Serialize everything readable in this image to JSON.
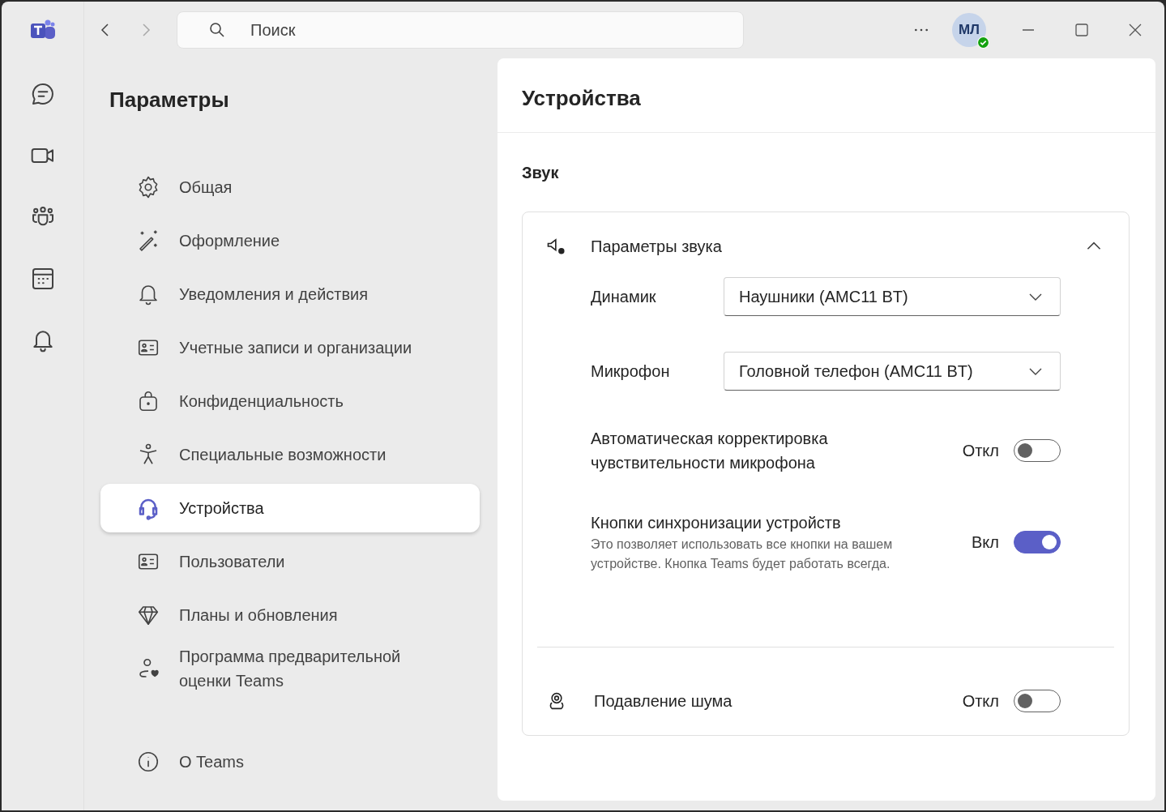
{
  "search": {
    "placeholder": "Поиск"
  },
  "avatar": {
    "initials": "МЛ"
  },
  "settings_nav": {
    "title": "Параметры",
    "items": [
      {
        "label": "Общая",
        "selected": false
      },
      {
        "label": "Оформление",
        "selected": false
      },
      {
        "label": "Уведомления и действия",
        "selected": false
      },
      {
        "label": "Учетные записи и организации",
        "selected": false
      },
      {
        "label": "Конфиденциальность",
        "selected": false
      },
      {
        "label": "Специальные возможности",
        "selected": false
      },
      {
        "label": "Устройства",
        "selected": true
      },
      {
        "label": "Пользователи",
        "selected": false
      },
      {
        "label": "Планы и обновления",
        "selected": false
      },
      {
        "label": "Программа предварительной оценки Teams",
        "selected": false
      }
    ],
    "about": {
      "label": "О Teams",
      "selected": false
    }
  },
  "page": {
    "title": "Устройства",
    "section": "Звук",
    "audio_card": {
      "title": "Параметры звука",
      "expanded": true,
      "rows": [
        {
          "kind": "dropdown",
          "label": "Динамик",
          "value": "Наушники (AMC11 BT)"
        },
        {
          "kind": "dropdown",
          "label": "Микрофон",
          "value": "Головной телефон (AMC11 BT)"
        },
        {
          "kind": "toggle",
          "label": "Автоматическая корректировка чувствительности микрофона",
          "state_label": "Откл",
          "on": false
        },
        {
          "kind": "toggle",
          "label": "Кнопки синхронизации устройств",
          "description": "Это позволяет использовать все кнопки на вашем устройстве. Кнопка Teams будет работать всегда.",
          "state_label": "Вкл",
          "on": true
        }
      ]
    },
    "noise": {
      "label": "Подавление шума",
      "state_label": "Откл",
      "on": false
    }
  }
}
